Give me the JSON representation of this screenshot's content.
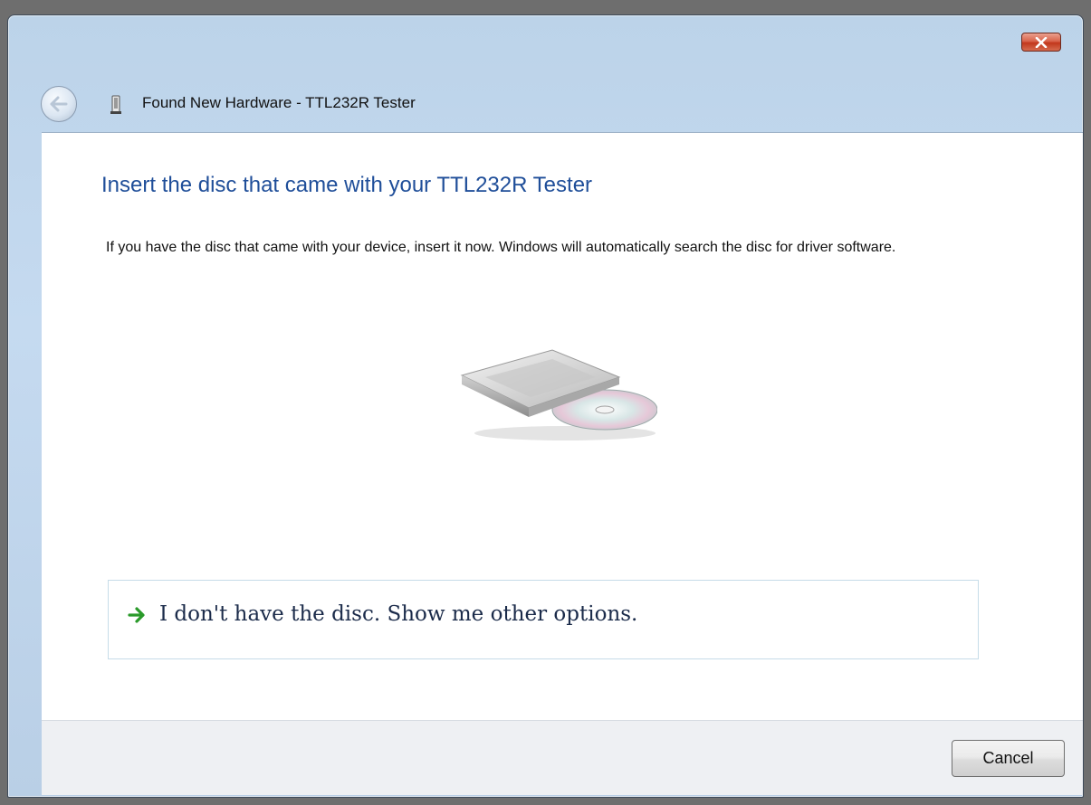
{
  "window": {
    "title": "Found New Hardware - TTL232R Tester",
    "close_icon": "close-icon",
    "back_icon": "back-arrow-icon",
    "title_icon": "usb-device-icon"
  },
  "main": {
    "heading": "Insert the disc that came with your TTL232R Tester",
    "body": "If you have the disc that came with your device, insert it now.  Windows will automatically search the disc for driver software.",
    "illustration": "disc-drive-icon",
    "option": {
      "icon": "green-arrow-icon",
      "label": "I don't have the disc.  Show me other options."
    }
  },
  "footer": {
    "cancel_label": "Cancel"
  },
  "colors": {
    "heading": "#1f4e99",
    "frame": "#bcd3e9",
    "close_button": "#c2371c",
    "option_arrow": "#2a9a2a"
  }
}
